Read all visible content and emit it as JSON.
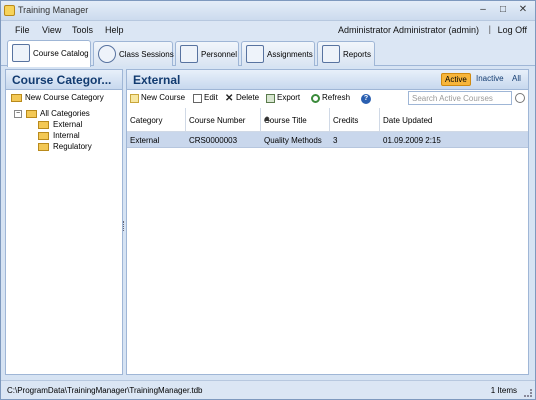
{
  "window": {
    "title": "Training Manager"
  },
  "menu": {
    "items": [
      "File",
      "View",
      "Tools",
      "Help"
    ],
    "user": "Administrator Administrator (admin)",
    "separator": "|",
    "logoff": "Log Off"
  },
  "tabs": [
    {
      "label": "Course Catalog",
      "icon": "book-icon",
      "active": true
    },
    {
      "label": "Class Sessions",
      "icon": "clock-icon",
      "active": false
    },
    {
      "label": "Personnel",
      "icon": "id-card-icon",
      "active": false
    },
    {
      "label": "Assignments",
      "icon": "clipboard-icon",
      "active": false
    },
    {
      "label": "Reports",
      "icon": "printer-icon",
      "active": false
    }
  ],
  "sidebar": {
    "title": "Course Categor...",
    "new_category": "New Course Category",
    "tree": {
      "expander": "−",
      "root": "All Categories",
      "children": [
        "External",
        "Internal",
        "Regulatory"
      ]
    }
  },
  "main": {
    "title": "External",
    "filters": [
      "Active",
      "Inactive",
      "All"
    ],
    "toolbar": {
      "new": "New Course",
      "edit": "Edit",
      "delete": "Delete",
      "export": "Export",
      "refresh": "Refresh"
    },
    "search_placeholder": "Search Active Courses",
    "columns": [
      "Category",
      "Course Number",
      "Course Title",
      "Credits",
      "Date Updated"
    ],
    "rows": [
      [
        "External",
        "CRS0000003",
        "Quality Methods",
        "3",
        "01.09.2009 2:15"
      ]
    ]
  },
  "status": {
    "path": "C:\\ProgramData\\TrainingManager\\TrainingManager.tdb",
    "count": "1 Items"
  },
  "colors": {
    "accent": "#123b70",
    "active_filter": "#f7b53a",
    "selected_row": "#c9d7ec"
  }
}
